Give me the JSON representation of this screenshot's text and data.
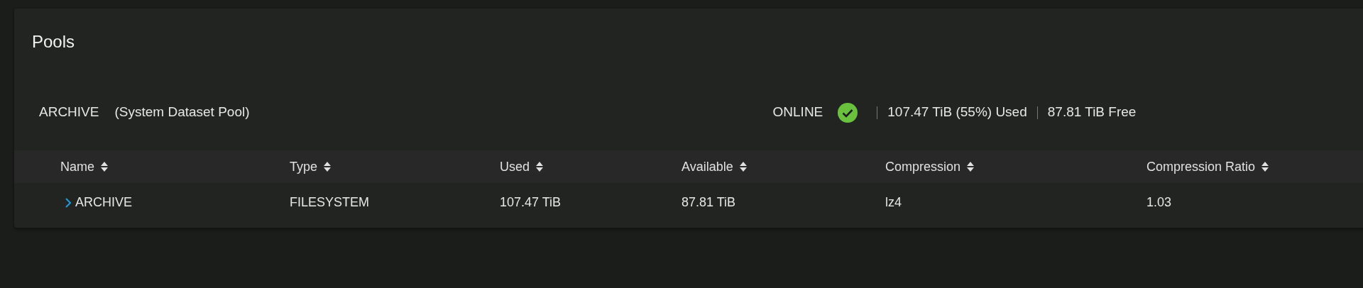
{
  "card": {
    "title": "Pools"
  },
  "pool": {
    "name": "ARCHIVE",
    "note": "(System Dataset Pool)",
    "status": "ONLINE",
    "healthy": true,
    "used": "107.47 TiB (55%) Used",
    "free": "87.81 TiB Free"
  },
  "table": {
    "columns": [
      "Name",
      "Type",
      "Used",
      "Available",
      "Compression",
      "Compression Ratio"
    ],
    "rows": [
      {
        "expanded": false,
        "cells": [
          "ARCHIVE",
          "FILESYSTEM",
          "107.47 TiB",
          "87.81 TiB",
          "lz4",
          "1.03"
        ]
      }
    ]
  }
}
